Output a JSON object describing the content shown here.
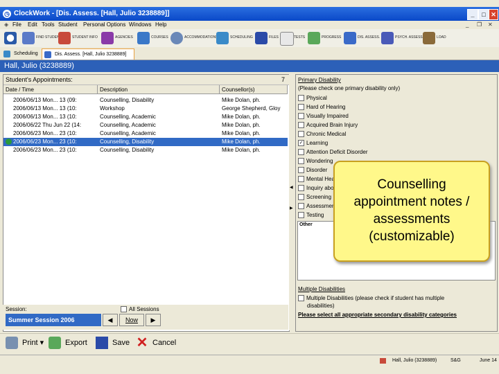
{
  "window": {
    "title": "ClockWork - [Dis. Assess. [Hall, Julio 3238889]]",
    "min_label": "_",
    "max_label": "□",
    "close_label": "✕"
  },
  "menu": [
    "File",
    "Edit",
    "Tools",
    "Student",
    "Personal Options",
    "Windows",
    "Help"
  ],
  "toolbar": {
    "items": [
      {
        "label": "",
        "icon": "clock-icon"
      },
      {
        "label": "FIND STUDENT",
        "icon": "find-student-icon"
      },
      {
        "label": "STUDENT INFO",
        "icon": "student-info-icon"
      },
      {
        "label": "AGENCIES",
        "icon": "agencies-icon"
      },
      {
        "label": "COURSES",
        "icon": "courses-icon"
      },
      {
        "label": "ACCOMMODATIONS",
        "icon": "accommodations-icon"
      },
      {
        "label": "SCHEDULING",
        "icon": "scheduling-icon"
      },
      {
        "label": "FILES",
        "icon": "files-icon"
      },
      {
        "label": "TESTS",
        "icon": "tests-icon"
      },
      {
        "label": "PROGRESS",
        "icon": "progress-icon"
      },
      {
        "label": "DIS. ASSESS.",
        "icon": "dis-assess-icon"
      },
      {
        "label": "PSYCH. ASSESS.",
        "icon": "psych-assess-icon"
      },
      {
        "label": "LOAD",
        "icon": "load-icon"
      }
    ]
  },
  "tabs": [
    {
      "label": "Scheduling"
    },
    {
      "label": "Dis. Assess. [Hall, Julio 3238889]"
    }
  ],
  "student": {
    "name": "Hall, Julio (3238889)"
  },
  "appointments": {
    "header": "Student's Appointments:",
    "count": "7",
    "columns": [
      "Date / Time",
      "Description",
      "Counsellor(s)"
    ],
    "rows": [
      {
        "date": "2006/06/13 Mon... 13 (09:",
        "desc": "Counselling, Disability",
        "counsellor": "Mike Dolan, ph.",
        "selected": false,
        "checked": false
      },
      {
        "date": "2006/06/13 Mon... 13 (10:",
        "desc": "Workshop",
        "counsellor": "George Shepherd, Gloy",
        "selected": false,
        "checked": false
      },
      {
        "date": "2006/06/13 Mon... 13 (10:",
        "desc": "Counselling, Academic",
        "counsellor": "Mike Dolan, ph.",
        "selected": false,
        "checked": false
      },
      {
        "date": "2006/06/22 Thu Jun 22 (14:",
        "desc": "Counselling, Academic",
        "counsellor": "Mike Dolan, ph.",
        "selected": false,
        "checked": false
      },
      {
        "date": "2006/06/23 Mon... 23 (10:",
        "desc": "Counselling, Academic",
        "counsellor": "Mike Dolan, ph.",
        "selected": false,
        "checked": false
      },
      {
        "date": "2006/06/23 Mon... 23 (10:",
        "desc": "Counselling, Disability",
        "counsellor": "Mike Dolan, ph.",
        "selected": true,
        "checked": true
      },
      {
        "date": "2006/06/23 Mon... 23 (10:",
        "desc": "Counselling, Disability",
        "counsellor": "Mike Dolan, ph.",
        "selected": false,
        "checked": false
      }
    ]
  },
  "session": {
    "label": "Session:",
    "all_label": "All Sessions",
    "value": "Summer Session 2006",
    "prev": "◀",
    "now": "Now",
    "next": "▶"
  },
  "disability": {
    "primary_title": "Primary Disability",
    "primary_hint": "(Please check one primary disability only)",
    "options": [
      {
        "label": "Physical",
        "checked": false
      },
      {
        "label": "Hard of Hearing",
        "checked": false
      },
      {
        "label": "Visually Impaired",
        "checked": false
      },
      {
        "label": "Acquired Brain Injury",
        "checked": false
      },
      {
        "label": "Chronic Medical",
        "checked": false
      },
      {
        "label": "Learning",
        "checked": true
      },
      {
        "label": "Attention Deficit Disorder",
        "checked": false
      },
      {
        "label": "Wondering",
        "checked": false
      },
      {
        "label": "Disorder",
        "checked": false
      },
      {
        "label": "Mental Health",
        "checked": false
      },
      {
        "label": "Inquiry about",
        "checked": false
      },
      {
        "label": "Screening",
        "checked": false
      },
      {
        "label": "Assessment",
        "checked": false
      },
      {
        "label": "Testing",
        "checked": false
      }
    ],
    "other_label": "Other",
    "multiple_title": "Multiple Disabilities",
    "multiple_option": "Multiple Disabilities (please check if student has multiple",
    "multiple_option2": "disabilities)",
    "secondary_title": "Please select all appropriate secondary disability categories"
  },
  "callout": {
    "lines": [
      "Counselling",
      "appointment notes /",
      "assessments",
      "(customizable)"
    ]
  },
  "bottom": {
    "print": "Print",
    "export": "Export",
    "save": "Save",
    "cancel": "Cancel"
  },
  "status": {
    "user": "Hall, Julio (3238889)",
    "status_code": "S&G",
    "date": "June 14"
  },
  "colors": {
    "title": "#0a48c8",
    "selection": "#316ac5",
    "student_bar": "#2c60b8",
    "callout": "#fff88a"
  }
}
